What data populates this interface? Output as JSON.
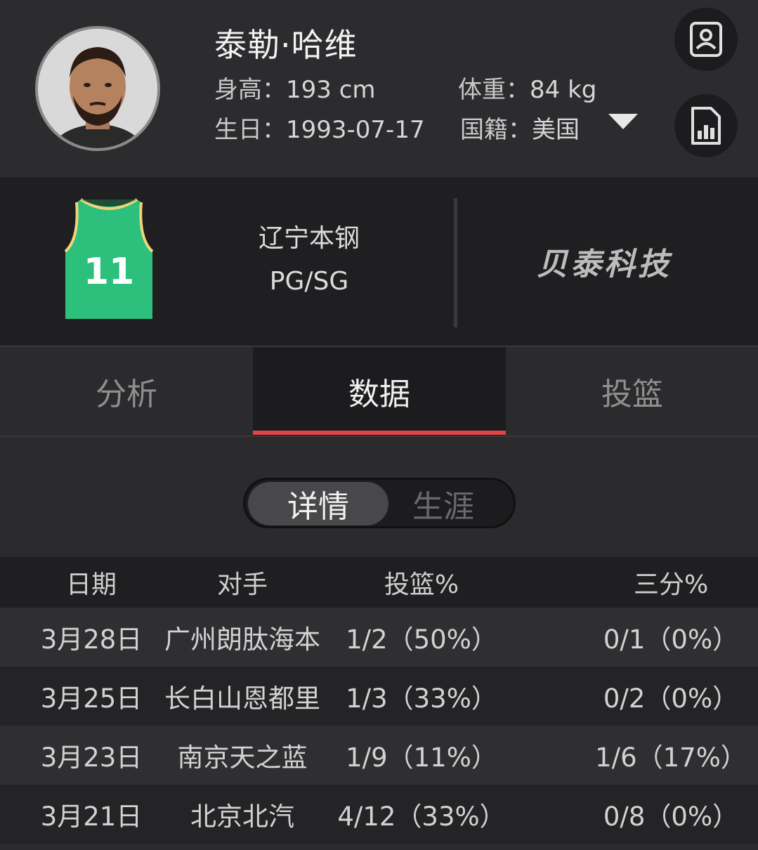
{
  "player": {
    "name": "泰勒·哈维",
    "height_label": "身高：",
    "height_value": "193 cm",
    "weight_label": "体重：",
    "weight_value": "84 kg",
    "birthday_label": "生日：",
    "birthday_value": "1993-07-17",
    "nationality_label": "国籍：",
    "nationality_value": "美国",
    "avatar_icon": "player-portrait",
    "jersey_number": "11",
    "jersey_color": "#2dbf7c"
  },
  "header_buttons": {
    "profile_icon": "profile-card-icon",
    "stats_icon": "bar-chart-document-icon"
  },
  "team": {
    "name": "辽宁本钢",
    "position": "PG/SG",
    "brand": "贝泰科技"
  },
  "tabs": [
    {
      "label": "分析",
      "active": false
    },
    {
      "label": "数据",
      "active": true
    },
    {
      "label": "投篮",
      "active": false
    }
  ],
  "accent_color": "#e0474a",
  "segment": {
    "options": [
      {
        "label": "详情",
        "selected": true
      },
      {
        "label": "生涯",
        "selected": false
      }
    ]
  },
  "table": {
    "headers": [
      "日期",
      "对手",
      "投篮%",
      "三分%"
    ],
    "rows": [
      {
        "date": "3月28日",
        "opponent": "广州朗肽海本",
        "fg": "1/2（50%）",
        "three": "0/1（0%）"
      },
      {
        "date": "3月25日",
        "opponent": "长白山恩都里",
        "fg": "1/3（33%）",
        "three": "0/2（0%）"
      },
      {
        "date": "3月23日",
        "opponent": "南京天之蓝",
        "fg": "1/9（11%）",
        "three": "1/6（17%）"
      },
      {
        "date": "3月21日",
        "opponent": "北京北汽",
        "fg": "4/12（33%）",
        "three": "0/8（0%）"
      }
    ]
  }
}
